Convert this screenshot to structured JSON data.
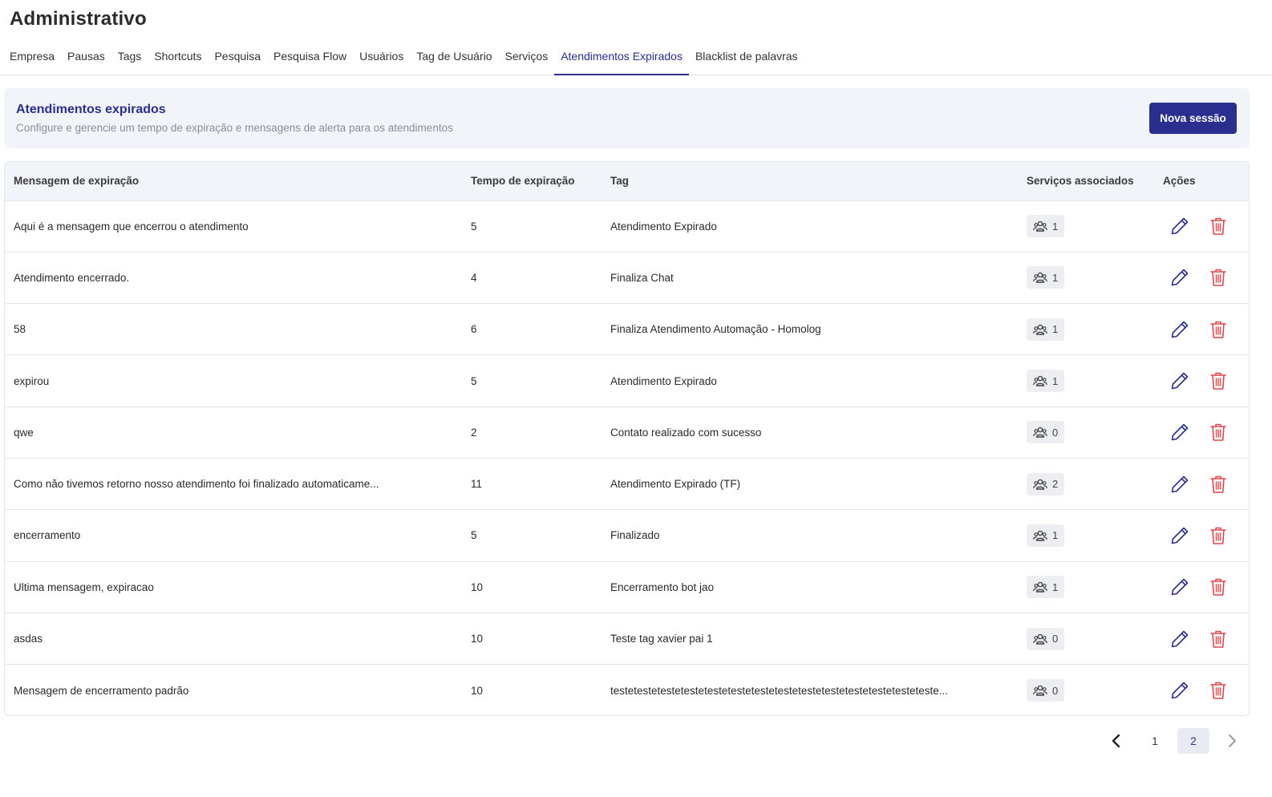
{
  "header": {
    "title": "Administrativo"
  },
  "tabs": [
    {
      "label": "Empresa",
      "active": false
    },
    {
      "label": "Pausas",
      "active": false
    },
    {
      "label": "Tags",
      "active": false
    },
    {
      "label": "Shortcuts",
      "active": false
    },
    {
      "label": "Pesquisa",
      "active": false
    },
    {
      "label": "Pesquisa Flow",
      "active": false
    },
    {
      "label": "Usuários",
      "active": false
    },
    {
      "label": "Tag de Usuário",
      "active": false
    },
    {
      "label": "Serviços",
      "active": false
    },
    {
      "label": "Atendimentos Expirados",
      "active": true
    },
    {
      "label": "Blacklist de palavras",
      "active": false
    }
  ],
  "banner": {
    "title": "Atendimentos expirados",
    "subtitle": "Configure e gerencie um tempo de expiração e mensagens de alerta para os atendimentos",
    "new_button": "Nova sessão"
  },
  "table": {
    "headers": {
      "message": "Mensagem de expiração",
      "time": "Tempo de expiração",
      "tag": "Tag",
      "services": "Serviços associados",
      "actions": "Ações"
    },
    "rows": [
      {
        "message": "Aqui é a mensagem que encerrou o atendimento",
        "time": "5",
        "tag": "Atendimento Expirado",
        "services": "1"
      },
      {
        "message": "Atendimento encerrado.",
        "time": "4",
        "tag": "Finaliza Chat",
        "services": "1"
      },
      {
        "message": "58",
        "time": "6",
        "tag": "Finaliza Atendimento Automação - Homolog",
        "services": "1"
      },
      {
        "message": "expirou",
        "time": "5",
        "tag": "Atendimento Expirado",
        "services": "1"
      },
      {
        "message": "qwe",
        "time": "2",
        "tag": "Contato realizado com sucesso",
        "services": "0"
      },
      {
        "message": "Como não tivemos retorno nosso atendimento foi finalizado automaticame...",
        "time": "11",
        "tag": "Atendimento Expirado (TF)",
        "services": "2"
      },
      {
        "message": "encerramento",
        "time": "5",
        "tag": "Finalizado",
        "services": "1"
      },
      {
        "message": "Ultima mensagem, expiracao",
        "time": "10",
        "tag": "Encerramento bot jao",
        "services": "1"
      },
      {
        "message": "asdas",
        "time": "10",
        "tag": "Teste tag xavier pai 1",
        "services": "0"
      },
      {
        "message": "Mensagem de encerramento padrão",
        "time": "10",
        "tag": "testetestetestetestetestetestetestetestetestetestetestetestetesteteste...",
        "services": "0"
      }
    ]
  },
  "pagination": {
    "pages": [
      "1",
      "2"
    ],
    "current": "2"
  },
  "colors": {
    "primary": "#2a2f8f",
    "delete": "#e0474c",
    "header_bg": "#f1f4f8"
  },
  "icons": {
    "services": "group-icon",
    "edit": "pencil-icon",
    "delete": "trash-icon",
    "prev": "chevron-left-icon",
    "next": "chevron-right-icon"
  }
}
